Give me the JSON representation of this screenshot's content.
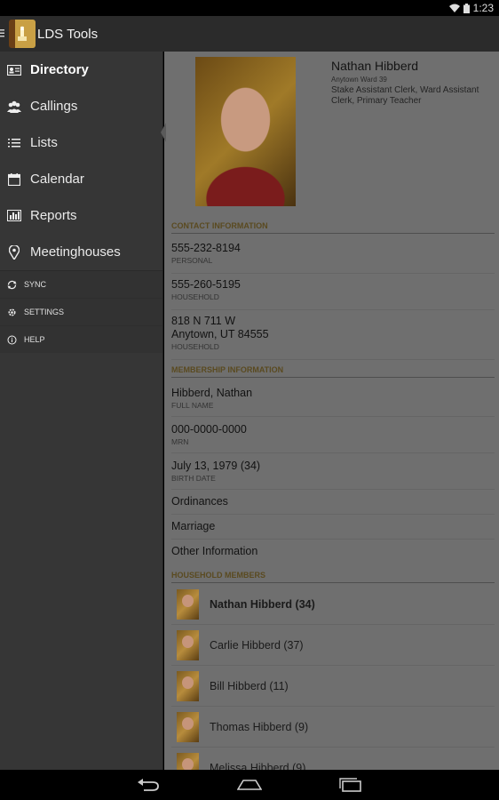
{
  "status_bar": {
    "time": "1:23",
    "icons": [
      "wifi-icon",
      "battery-icon"
    ]
  },
  "app": {
    "title": "LDS Tools",
    "icon": "lds-tools-app-icon"
  },
  "drawer": {
    "items": [
      {
        "label": "Directory",
        "icon": "contact-card-icon",
        "active": true
      },
      {
        "label": "Callings",
        "icon": "people-icon",
        "active": false
      },
      {
        "label": "Lists",
        "icon": "list-icon",
        "active": false
      },
      {
        "label": "Calendar",
        "icon": "calendar-icon",
        "active": false
      },
      {
        "label": "Reports",
        "icon": "bar-chart-icon",
        "active": false
      },
      {
        "label": "Meetinghouses",
        "icon": "map-pin-icon",
        "active": false
      }
    ],
    "sub_items": [
      {
        "label": "SYNC",
        "icon": "sync-icon"
      },
      {
        "label": "SETTINGS",
        "icon": "gear-icon"
      },
      {
        "label": "HELP",
        "icon": "info-icon"
      }
    ]
  },
  "profile": {
    "name": "Nathan Hibberd",
    "ward": "Anytown Ward 39",
    "callings": "Stake Assistant Clerk, Ward Assistant Clerk, Primary Teacher"
  },
  "contact": {
    "header": "CONTACT INFORMATION",
    "rows": [
      {
        "value": "555-232-8194",
        "label": "PERSONAL"
      },
      {
        "value": "555-260-5195",
        "label": "HOUSEHOLD"
      },
      {
        "value_line1": "818 N 711 W",
        "value_line2": "Anytown, UT 84555",
        "label": "HOUSEHOLD"
      }
    ]
  },
  "membership": {
    "header": "MEMBERSHIP INFORMATION",
    "rows": [
      {
        "value": "Hibberd, Nathan",
        "label": "FULL NAME"
      },
      {
        "value": "000-0000-0000",
        "label": "MRN"
      },
      {
        "value": "July 13, 1979 (34)",
        "label": "BIRTH DATE"
      }
    ],
    "links": [
      "Ordinances",
      "Marriage",
      "Other Information"
    ]
  },
  "household": {
    "header": "HOUSEHOLD MEMBERS",
    "members": [
      {
        "name": "Nathan Hibberd (34)",
        "bold": true
      },
      {
        "name": "Carlie Hibberd (37)",
        "bold": false
      },
      {
        "name": "Bill Hibberd (11)",
        "bold": false
      },
      {
        "name": "Thomas Hibberd (9)",
        "bold": false
      },
      {
        "name": "Melissa Hibberd (9)",
        "bold": false
      }
    ]
  }
}
